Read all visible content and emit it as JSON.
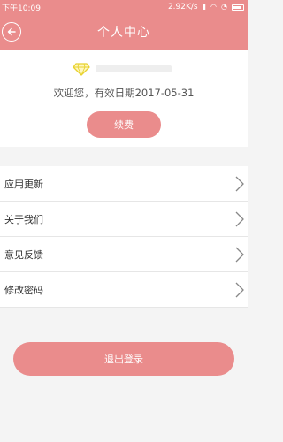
{
  "status_bar": {
    "time": "下午10:09",
    "network_speed": "2.92K/s"
  },
  "header": {
    "title": "个人中心",
    "back_icon": "back-arrow-icon"
  },
  "profile": {
    "vip_icon": "diamond-icon",
    "welcome_text": "欢迎您，有效日期2017-05-31",
    "renew_label": "续费"
  },
  "menu": {
    "items": [
      {
        "label": "应用更新",
        "icon": "chevron-right-icon"
      },
      {
        "label": "关于我们",
        "icon": "chevron-right-icon"
      },
      {
        "label": "意见反馈",
        "icon": "chevron-right-icon"
      },
      {
        "label": "修改密码",
        "icon": "chevron-right-icon"
      }
    ]
  },
  "logout_label": "退出登录",
  "colors": {
    "accent": "#ea8c8c",
    "background": "#f4f4f4",
    "diamond": "#e8d22e"
  }
}
